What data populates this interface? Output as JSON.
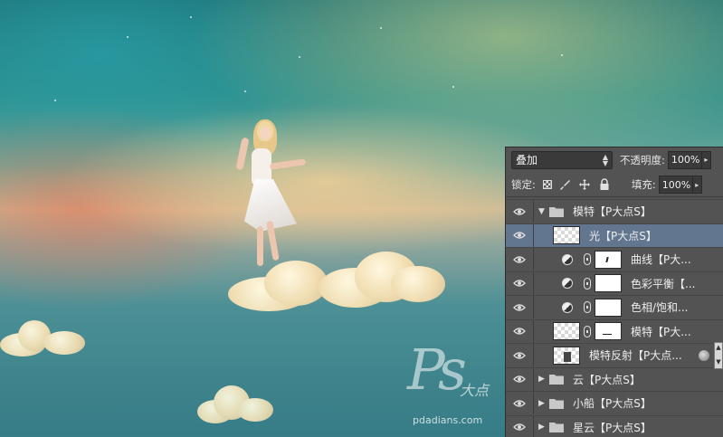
{
  "canvas": {
    "watermark": {
      "logo_text": "Ps",
      "cn_text": "大点",
      "url": "pdadians.com"
    }
  },
  "layers_panel": {
    "blend_mode": "叠加",
    "opacity_label": "不透明度:",
    "opacity_value": "100%",
    "lock_label": "锁定:",
    "fill_label": "填充:",
    "fill_value": "100%",
    "layers": [
      {
        "name": "模特【P大点S】",
        "kind": "group",
        "expanded": true,
        "visible": true
      },
      {
        "name": "光【P大点S】",
        "kind": "pixel",
        "selected": true,
        "visible": true
      },
      {
        "name": "曲线【P大...",
        "kind": "adjustment",
        "visible": true
      },
      {
        "name": "色彩平衡【...",
        "kind": "adjustment",
        "visible": true
      },
      {
        "name": "色相/饱和...",
        "kind": "adjustment",
        "visible": true
      },
      {
        "name": "模特【P大...",
        "kind": "masked",
        "visible": true
      },
      {
        "name": "模特反射【P大点...",
        "kind": "pixel-fx",
        "visible": true
      },
      {
        "name": "云【P大点S】",
        "kind": "group",
        "expanded": false,
        "visible": true
      },
      {
        "name": "小船【P大点S】",
        "kind": "group",
        "expanded": false,
        "visible": true
      },
      {
        "name": "星云【P大点S】",
        "kind": "group",
        "expanded": false,
        "visible": true
      }
    ]
  },
  "icons": {
    "eye": "eye-icon",
    "folder": "folder-icon",
    "link": "link-icon",
    "lock": "lock-icon",
    "brush": "brush-icon",
    "move": "move-icon",
    "transparency_lock": "checker-icon"
  },
  "colors": {
    "panel_bg": "#535353",
    "selected_row": "#627690",
    "field_bg": "#3a3a3a"
  }
}
